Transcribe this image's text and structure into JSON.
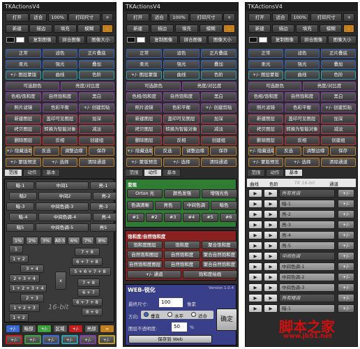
{
  "window_title": "TKActionsV4",
  "top": {
    "open": "打开",
    "fit": "适合",
    "zoom": "100%",
    "print": "打印尺寸",
    "plus": "+",
    "new": "新建",
    "stroke": "描边",
    "fill": "填充",
    "blur": "模糊",
    "minus": "-",
    "copy_image": "复制图像",
    "flatten": "拼合图像",
    "image_size": "图像大小"
  },
  "ops": [
    [
      "正常",
      "滤色",
      "正片叠底"
    ],
    [
      "柔光",
      "强光",
      "叠加"
    ],
    [
      "+/- 图层蒙版",
      "曲线",
      "色阶"
    ],
    [
      "可选颜色",
      "亮度/对比度"
    ],
    [
      "色相/饱和度",
      "自然饱和度",
      "黑白"
    ],
    [
      "照片滤镜",
      "色彩平衡",
      "+/- 创建剪贴"
    ],
    [
      "新建图层",
      "盖印可见图层",
      "加深"
    ],
    [
      "拷贝图层",
      "转换为智能对象",
      "减淡"
    ],
    [
      "删除图层",
      "反相",
      "创建组"
    ],
    [
      "+/- 隐藏选取",
      "反选",
      "调整边缘",
      "保存"
    ],
    [
      "+/- 蒙版预览",
      "+/- 选择",
      "清除通道"
    ]
  ],
  "tabs": [
    "范围",
    "动作",
    "基本"
  ],
  "p1": {
    "ranges": [
      [
        "暗-1",
        "中间1",
        "亮-1"
      ],
      [
        "暗2",
        "中间2",
        "亮-2"
      ],
      [
        "暗-3",
        "中间色调-3",
        "亮-3"
      ],
      [
        "暗-4",
        "中间色调-4",
        "亮-4"
      ],
      [
        "暗5",
        "中间色调-5",
        "亮5"
      ]
    ],
    "pct": [
      "1%",
      "2%",
      "3%",
      "All-5",
      "6%",
      "7%",
      "8%"
    ],
    "grid_left": [
      "1",
      "1 + 2",
      "3 + 4",
      "2 + 3 + 4",
      "1 + 2 + 3 + 4",
      "2 + 3",
      "1 + 2 + 3",
      "1 + 2"
    ],
    "grid_mid": "x",
    "grid_right": [
      "7 + 8",
      "6 + 7 + 8",
      "5 + 6 + 7 + 8",
      "7 + 8",
      "6 + 7",
      "6 + 7 + 8",
      "8 + 9"
    ],
    "logo": "16-bit",
    "bottom1": [
      "+/-",
      "暗部",
      "+/-",
      "区域",
      "+/-",
      "亮部",
      "∞"
    ],
    "bottom2": [
      "+/-",
      "+/-",
      "+/-",
      "+/-",
      "+/-",
      "+/-"
    ]
  },
  "p2": {
    "green_title": "变现",
    "green_rows": [
      [
        "Orton 光",
        "颜色发强",
        "增强光色"
      ],
      [
        "色调清晰",
        "亮色",
        "中间色调",
        "暗色"
      ],
      [
        "#1",
        "#2",
        "#3",
        "#4",
        "#5",
        "#6"
      ]
    ],
    "red_title": "饱和度/自然饱和度",
    "red_rows": [
      [
        "饱和度图层",
        "饱和度",
        "聚合饱和度"
      ],
      [
        "自然饱和图层",
        "自然饱和度",
        "聚合自然饱和度"
      ],
      [
        "自然饱和度图层",
        "自然饱和度",
        "聚合自然饱和度"
      ],
      [
        "+/- 通道",
        "饱和度绘画"
      ]
    ],
    "web_title": "WEB-锐化",
    "version": "Version 1.0.4",
    "size_label": "最终尺寸:",
    "size_value": "100",
    "size_unit": "像素",
    "dir_label": "方向:",
    "dir_opts": [
      "垂直",
      "水平",
      "适合"
    ],
    "opacity_label": "图层不透明度:",
    "opacity_value": "50",
    "opacity_unit": "%",
    "ok": "确定",
    "save_web": "保存到 Web"
  },
  "p3": {
    "header": [
      "曲线",
      "色阶",
      "TK 16-bit",
      "通道"
    ],
    "rows": [
      [
        "所有亮调",
        true
      ],
      [
        "暗-1",
        false
      ],
      [
        "亮-2",
        false
      ],
      [
        "亮-3",
        false
      ],
      [
        "亮-4",
        false
      ],
      [
        "亮-5",
        false
      ],
      [
        "中间色调",
        true
      ],
      [
        "中间色调-1",
        false
      ],
      [
        "中间色调-2",
        false
      ],
      [
        "中间色调-3",
        false
      ],
      [
        "所有暗调",
        true
      ],
      [
        "暗-1",
        false
      ]
    ],
    "pm": "+/-"
  },
  "watermark": {
    "brand": "脚本之家",
    "url": "www.jb51.net"
  }
}
